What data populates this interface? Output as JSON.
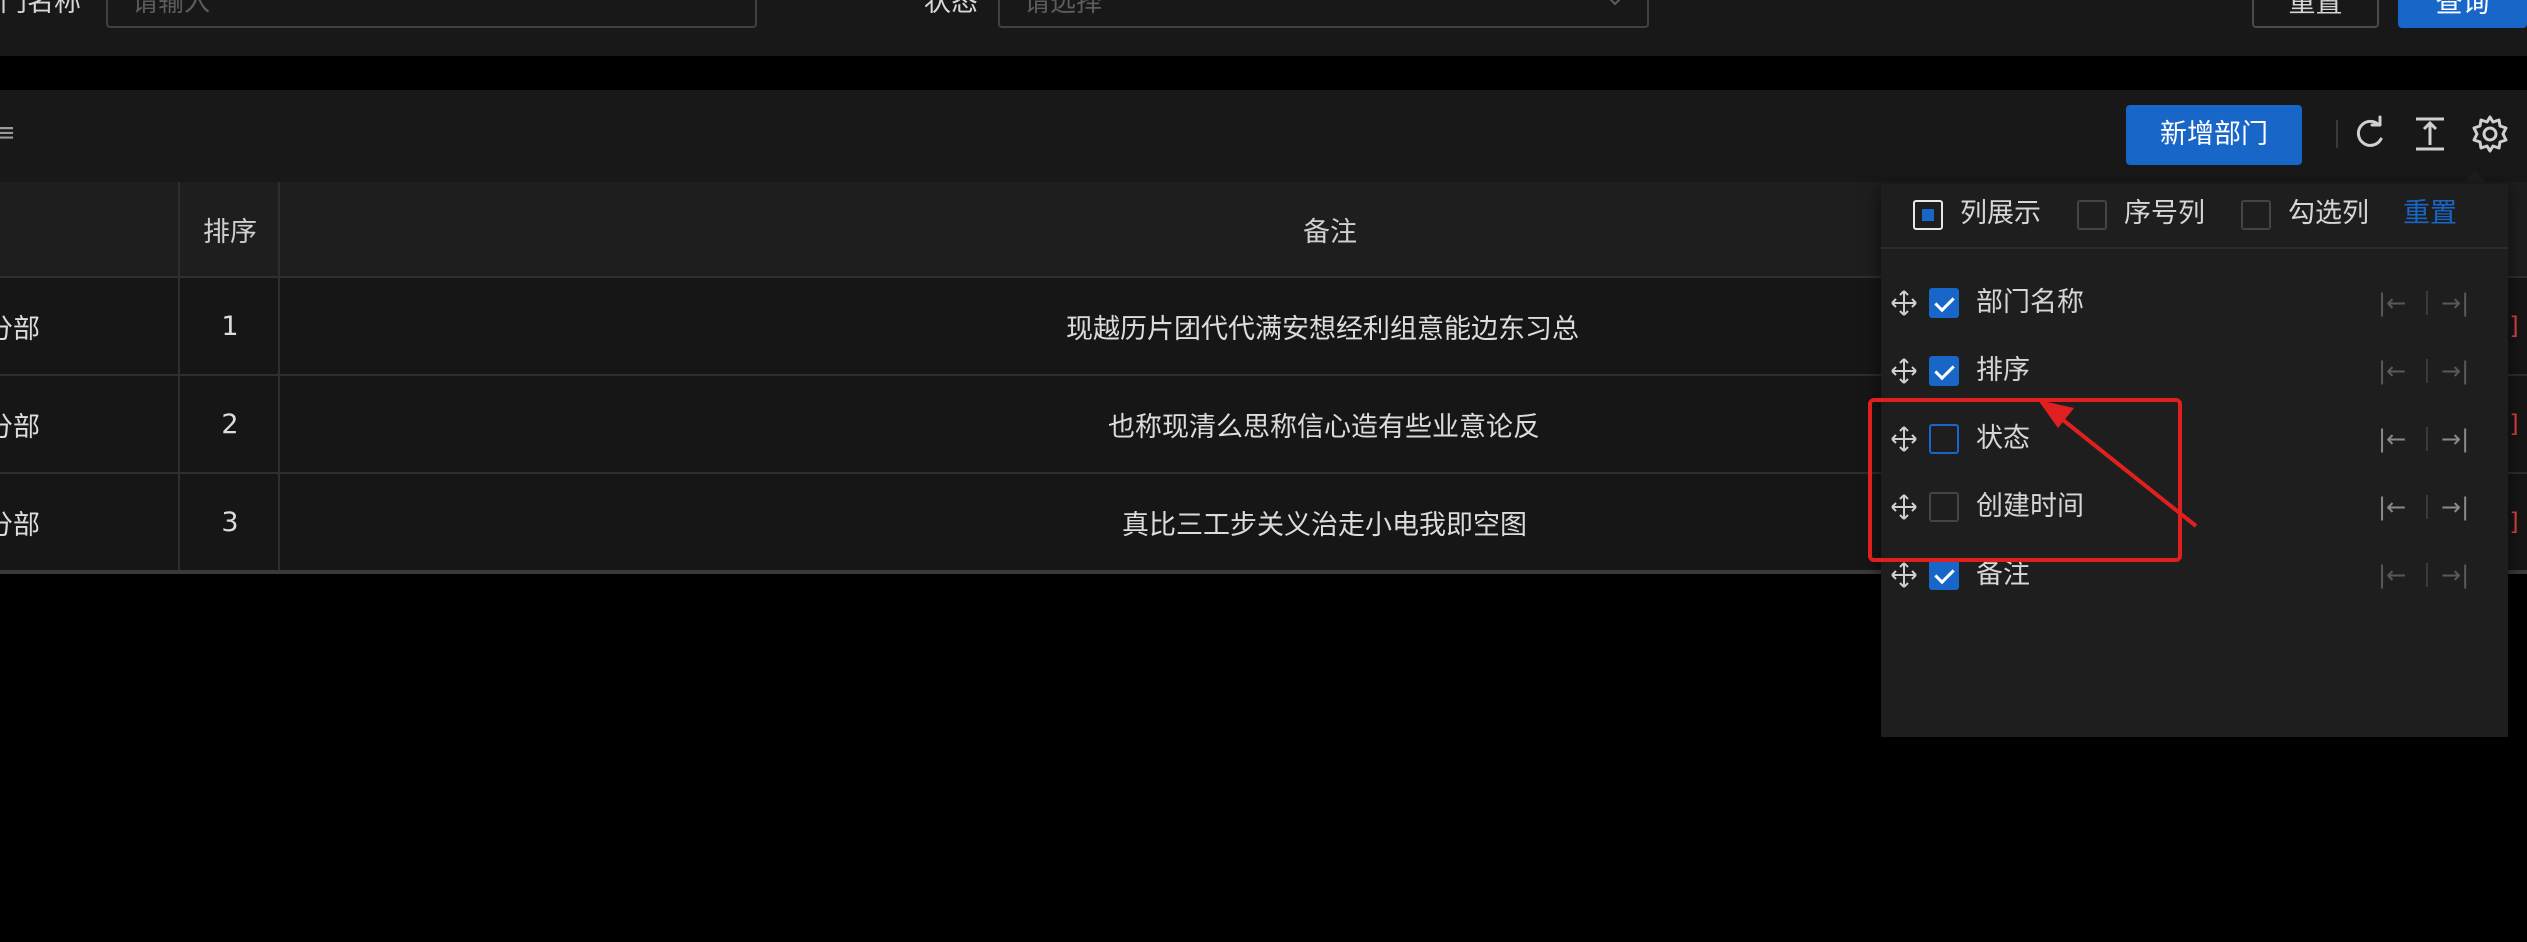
{
  "search": {
    "dept_name_label": "门名称",
    "dept_name_placeholder": "请输入",
    "status_label": "状态",
    "status_placeholder": "请选择",
    "reset_label": "重置",
    "query_label": "查询"
  },
  "toolbar": {
    "title_fragment": "≡",
    "add_label": "新增部门",
    "icons": [
      "refresh-icon",
      "column-height-icon",
      "settings-icon"
    ]
  },
  "table": {
    "headers": {
      "sort": "排序",
      "remark": "备注"
    },
    "rows": [
      {
        "name": "分部",
        "sort": "1",
        "remark": "现越历片团代代满安想经利组意能边东习总"
      },
      {
        "name": "分部",
        "sort": "2",
        "remark": "也称现清么思称信心造有些业意论反"
      },
      {
        "name": "分部",
        "sort": "3",
        "remark": "真比三工步关义治走小电我即空图"
      }
    ],
    "action_fragment": "]"
  },
  "column_settings": {
    "show_columns_label": "列展示",
    "index_column_label": "序号列",
    "selection_column_label": "勾选列",
    "reset_label": "重置",
    "items": [
      {
        "label": "部门名称",
        "checked": true
      },
      {
        "label": "排序",
        "checked": true
      },
      {
        "label": "状态",
        "checked": false
      },
      {
        "label": "创建时间",
        "checked": false
      },
      {
        "label": "备注",
        "checked": true
      }
    ],
    "pin_left_glyph": "|←",
    "pin_right_glyph": "→|"
  },
  "colors": {
    "primary": "#1766c8",
    "annotation_red": "#e02020",
    "background": "#000000",
    "panel": "#181818"
  }
}
